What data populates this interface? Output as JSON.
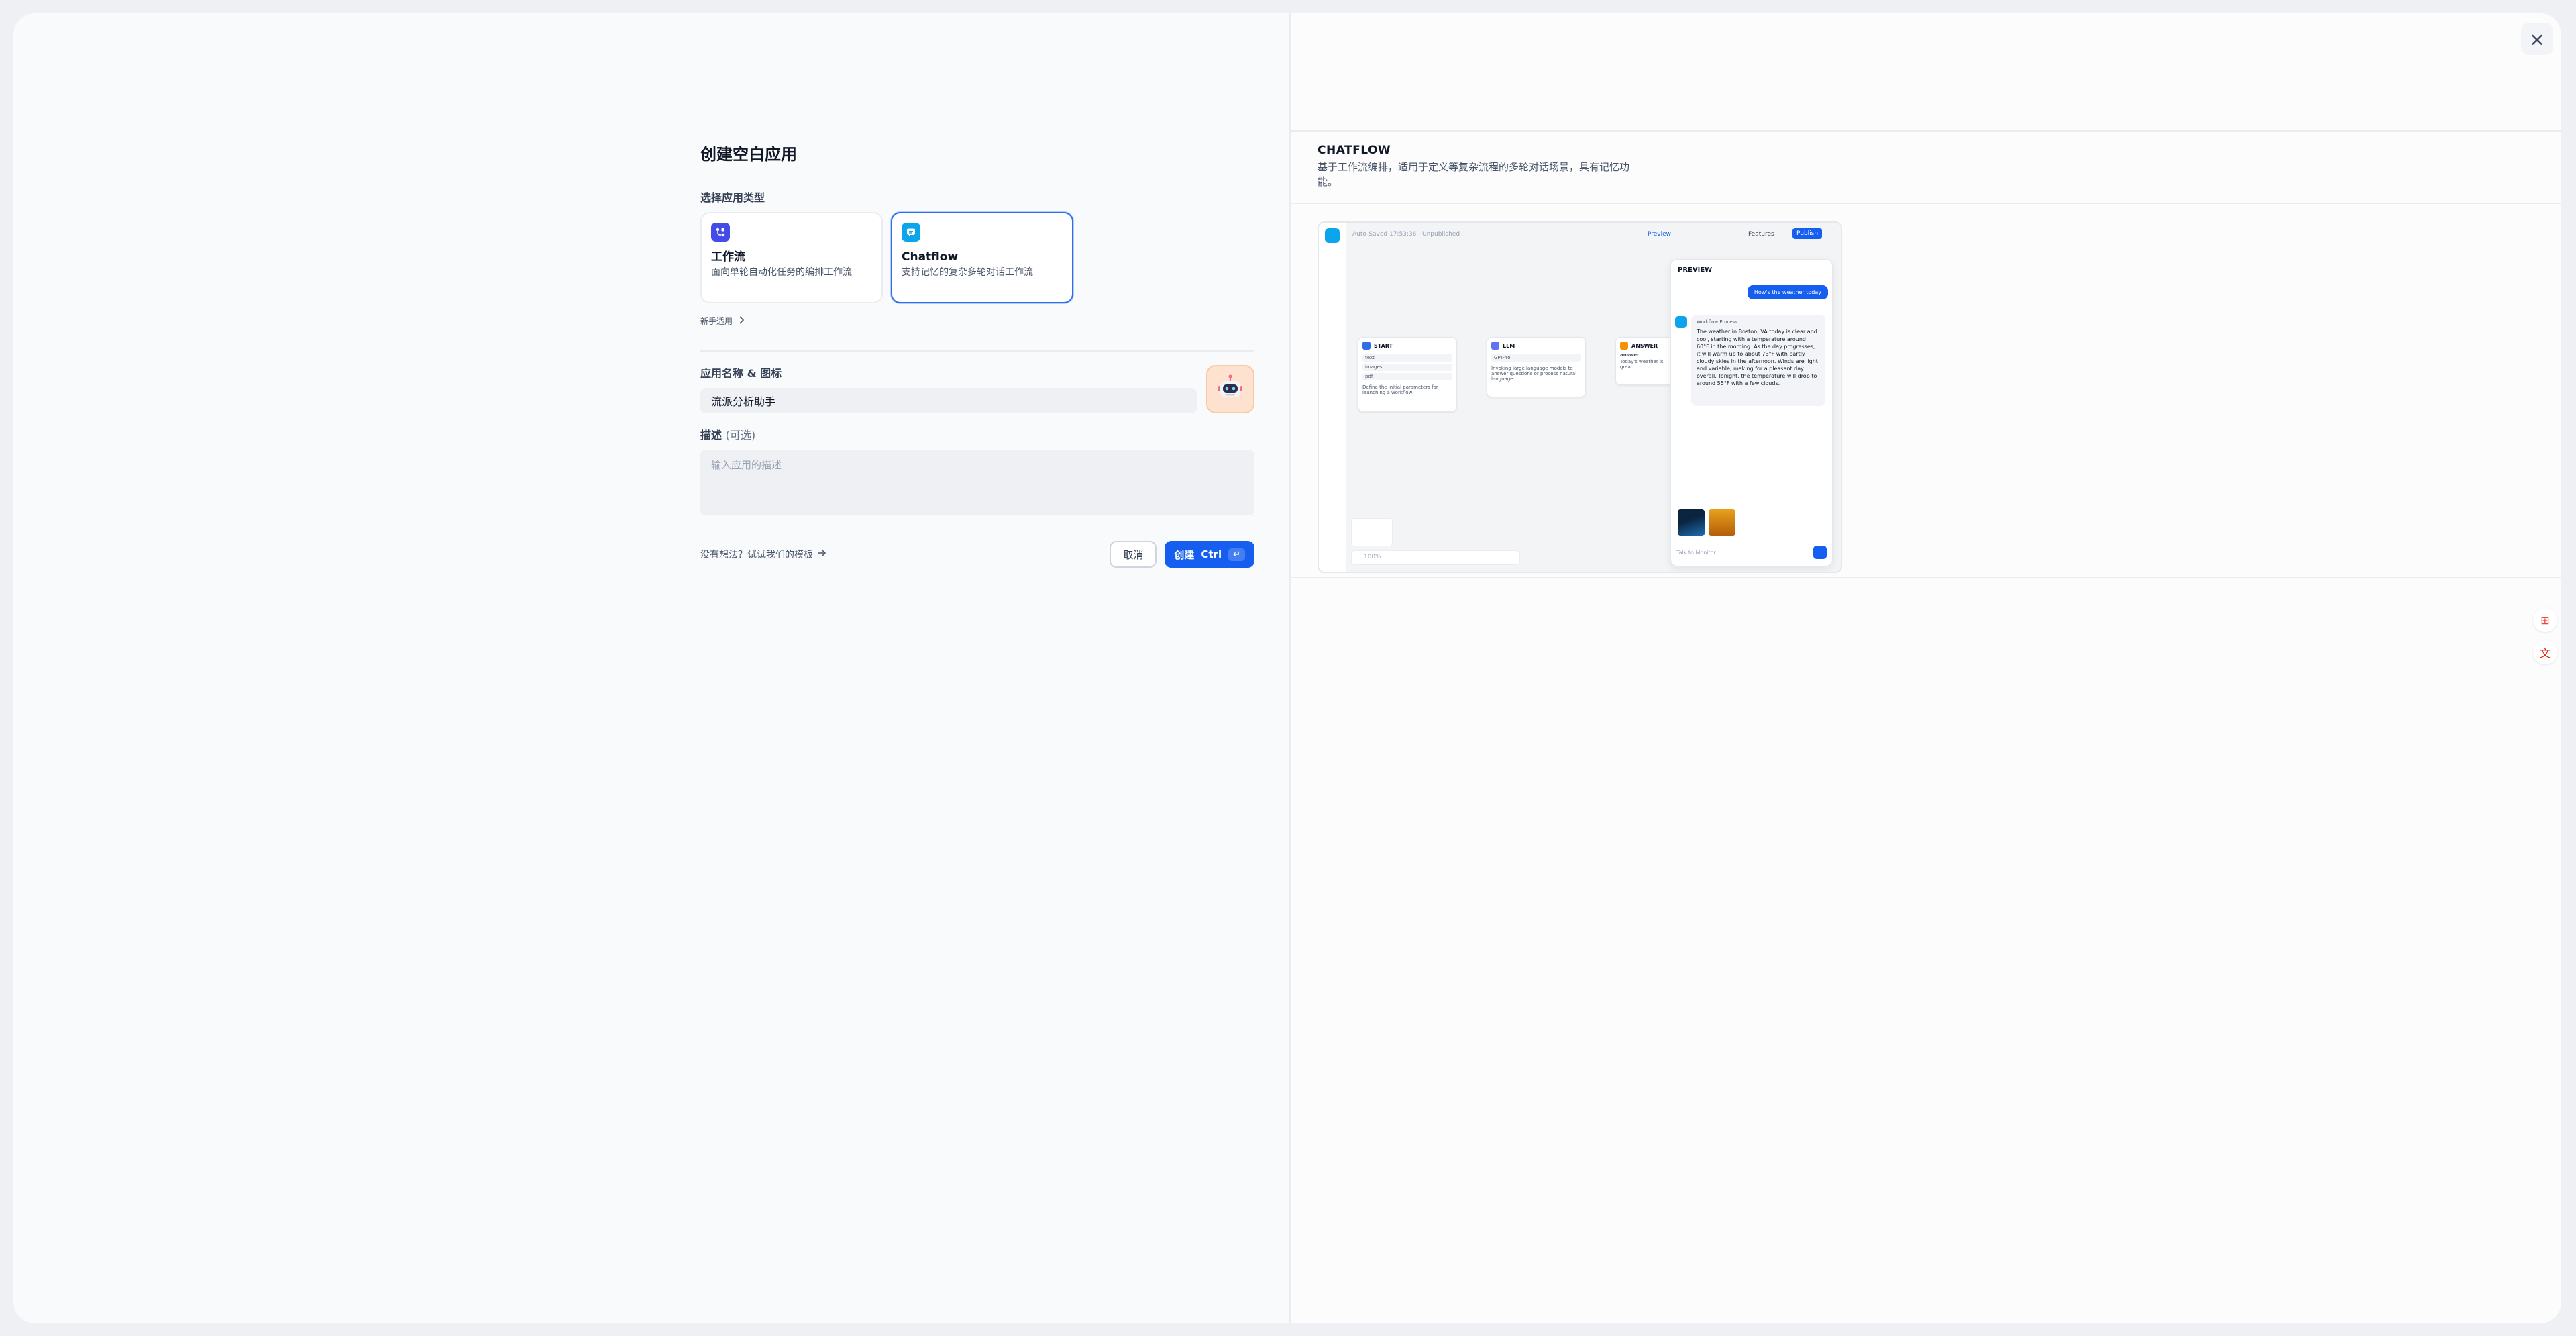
{
  "form": {
    "title": "创建空白应用",
    "type_label": "选择应用类型",
    "types": [
      {
        "name": "工作流",
        "desc": "面向单轮自动化任务的编排工作流",
        "icon": "workflow-icon",
        "selected": false
      },
      {
        "name": "Chatflow",
        "desc": "支持记忆的复杂多轮对话工作流",
        "icon": "chatflow-icon",
        "selected": true
      }
    ],
    "beginner_label": "新手适用",
    "name_label": "应用名称 & 图标",
    "name_value": "流派分析助手",
    "avatar_icon": "robot-icon",
    "desc_label": "描述",
    "desc_optional": "(可选)",
    "desc_placeholder": "输入应用的描述",
    "template_link": "没有想法？试试我们的模板",
    "cancel_label": "取消",
    "create_label": "创建",
    "create_shortcut": "Ctrl",
    "shortcut_enter_icon": "enter-icon"
  },
  "preview": {
    "title": "CHATFLOW",
    "desc": "基于工作流编排，适用于定义等复杂流程的多轮对话场景，具有记忆功能。",
    "mock": {
      "autosave": "Auto-Saved 17:53:36 · Unpublished",
      "preview_btn": "Preview",
      "features_btn": "Features",
      "publish_btn": "Publish",
      "nodes": [
        {
          "name": "START",
          "rows": [
            "text",
            "images",
            "pdf"
          ],
          "note": "Define the initial parameters for launching a workflow"
        },
        {
          "name": "LLM",
          "rows": [
            "GPT-4o"
          ],
          "note": "Invoking large language models to answer questions or process natural language"
        },
        {
          "name": "ANSWER",
          "rows": [
            "answer"
          ],
          "note": "Today's weather is great ..."
        }
      ],
      "chat_title": "PREVIEW",
      "user_message": "How's the weather today",
      "process_label": "Workflow Process",
      "bot_message": "The weather in Boston, VA today is clear and cool, starting with a temperature around 60°F in the morning. As the day progresses, it will warm up to about 73°F with partly cloudy skies in the afternoon. Winds are light and variable, making for a pleasant day overall. Tonight, the temperature will drop to around 55°F with a few clouds.",
      "input_placeholder": "Talk to Monitor",
      "zoom": "100%"
    }
  },
  "colors": {
    "primary": "#155eef",
    "workflow": "#444ce7",
    "chatflow": "#0ba5ec"
  }
}
